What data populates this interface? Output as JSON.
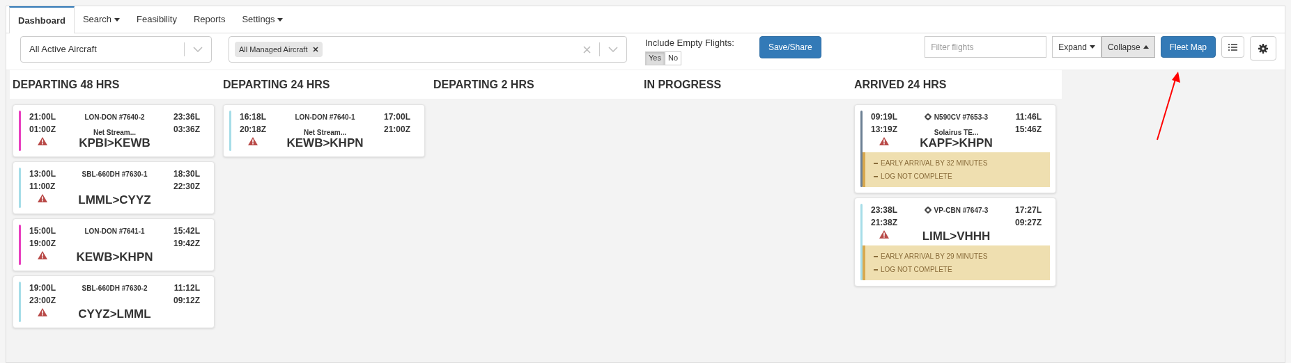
{
  "tabs": [
    {
      "label": "Dashboard",
      "selected": true,
      "has_menu": false
    },
    {
      "label": "Search",
      "selected": false,
      "has_menu": true
    },
    {
      "label": "Feasibility",
      "selected": false,
      "has_menu": false
    },
    {
      "label": "Reports",
      "selected": false,
      "has_menu": false
    },
    {
      "label": "Settings",
      "selected": false,
      "has_menu": true
    }
  ],
  "toolbar": {
    "aircraft_select": {
      "value": "All Active Aircraft"
    },
    "managed_select": {
      "tags": [
        "All Managed Aircraft"
      ]
    },
    "include_empty": {
      "label": "Include Empty Flights:",
      "options": [
        {
          "label": "Yes",
          "selected": true
        },
        {
          "label": "No",
          "selected": false
        }
      ]
    },
    "save_button": "Save/Share",
    "filter": {
      "placeholder": "Filter flights"
    },
    "expand_collapse": [
      {
        "label": "Expand",
        "selected": false,
        "kind": "expand"
      },
      {
        "label": "Collapse",
        "selected": true,
        "kind": "collapse"
      }
    ],
    "fleet_map_button": "Fleet Map"
  },
  "columns": [
    {
      "title": "DEPARTING 48 HRS",
      "flights": [
        {
          "color": "#e83fbf",
          "dep_local": "21:00L",
          "dep_zulu": "01:00Z",
          "arr_local": "23:36L",
          "arr_zulu": "03:36Z",
          "tracked": false,
          "trip": "LON-DON #7640-2",
          "client": "Net Stream...",
          "warning": true,
          "route": "KPBI>KEWB"
        },
        {
          "color": "#a6dde8",
          "dep_local": "13:00L",
          "dep_zulu": "11:00Z",
          "arr_local": "18:30L",
          "arr_zulu": "22:30Z",
          "tracked": false,
          "trip": "SBL-660DH #7630-1",
          "warning": true,
          "route": "LMML>CYYZ"
        },
        {
          "color": "#e83fbf",
          "dep_local": "15:00L",
          "dep_zulu": "19:00Z",
          "arr_local": "15:42L",
          "arr_zulu": "19:42Z",
          "tracked": false,
          "trip": "LON-DON #7641-1",
          "warning": true,
          "route": "KEWB>KHPN"
        },
        {
          "color": "#a6dde8",
          "dep_local": "19:00L",
          "dep_zulu": "23:00Z",
          "arr_local": "11:12L",
          "arr_zulu": "09:12Z",
          "tracked": false,
          "trip": "SBL-660DH #7630-2",
          "warning": true,
          "route": "CYYZ>LMML"
        }
      ]
    },
    {
      "title": "DEPARTING 24 HRS",
      "flights": [
        {
          "color": "#a6dde8",
          "dep_local": "16:18L",
          "dep_zulu": "20:18Z",
          "arr_local": "17:00L",
          "arr_zulu": "21:00Z",
          "tracked": false,
          "trip": "LON-DON #7640-1",
          "client": "Net Stream...",
          "warning": true,
          "route": "KEWB>KHPN"
        }
      ]
    },
    {
      "title": "DEPARTING 2 HRS"
    },
    {
      "title": "IN PROGRESS"
    },
    {
      "title": "ARRIVED 24 HRS",
      "flights": [
        {
          "color": "#6b7f93",
          "dep_local": "09:19L",
          "dep_zulu": "13:19Z",
          "arr_local": "11:46L",
          "arr_zulu": "15:46Z",
          "tracked": true,
          "trip": "N590CV #7653-3",
          "client": "Solairus TE...",
          "warning": true,
          "route": "KAPF>KHPN",
          "alerts": [
            "EARLY ARRIVAL BY 32 MINUTES",
            "LOG NOT COMPLETE"
          ]
        },
        {
          "color": "#a6dde8",
          "dep_local": "23:38L",
          "dep_zulu": "21:38Z",
          "arr_local": "17:27L",
          "arr_zulu": "09:27Z",
          "tracked": true,
          "trip": "VP-CBN #7647-3",
          "warning": true,
          "route": "LIML>VHHH",
          "alerts": [
            "EARLY ARRIVAL BY 29 MINUTES",
            "LOG NOT COMPLETE"
          ]
        }
      ]
    }
  ]
}
